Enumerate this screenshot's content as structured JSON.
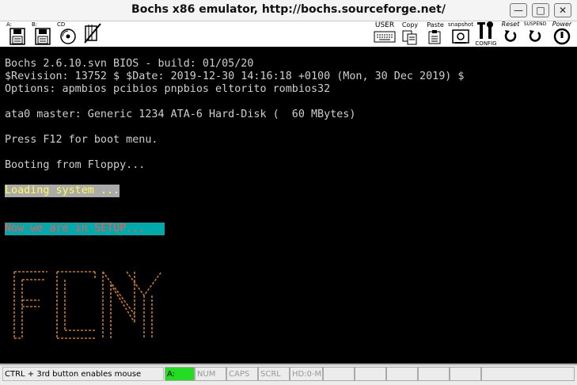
{
  "window": {
    "title": "Bochs x86 emulator, http://bochs.sourceforge.net/"
  },
  "toolbar": {
    "floppy_a_label": "A:",
    "floppy_b_label": "B:",
    "cdrom_label": "CD",
    "user_label": "USER",
    "copy_label": "Copy",
    "paste_label": "Paste",
    "snapshot_label": "snapshot",
    "config_label": "CONFIG",
    "reset_label": "Reset",
    "suspend_label": "SUSPEND",
    "power_label": "Power"
  },
  "screen": {
    "lines": [
      "Bochs 2.6.10.svn BIOS - build: 01/05/20",
      "$Revision: 13752 $ $Date: 2019-12-30 14:16:18 +0100 (Mon, 30 Dec 2019) $",
      "Options: apmbios pcibios pnpbios eltorito rombios32",
      "ata0 master: Generic 1234 ATA-6 Hard-Disk (  60 MBytes)",
      "Press F12 for boot menu.",
      "Booting from Floppy...",
      "Loading system ...",
      "Now we are in SETUP..."
    ],
    "logo_color": "#c87a1e"
  },
  "status": {
    "hint": "CTRL + 3rd button enables mouse",
    "floppy_a": "A:",
    "num": "NUM",
    "caps": "CAPS",
    "scrl": "SCRL",
    "hd": "HD:0-M"
  }
}
